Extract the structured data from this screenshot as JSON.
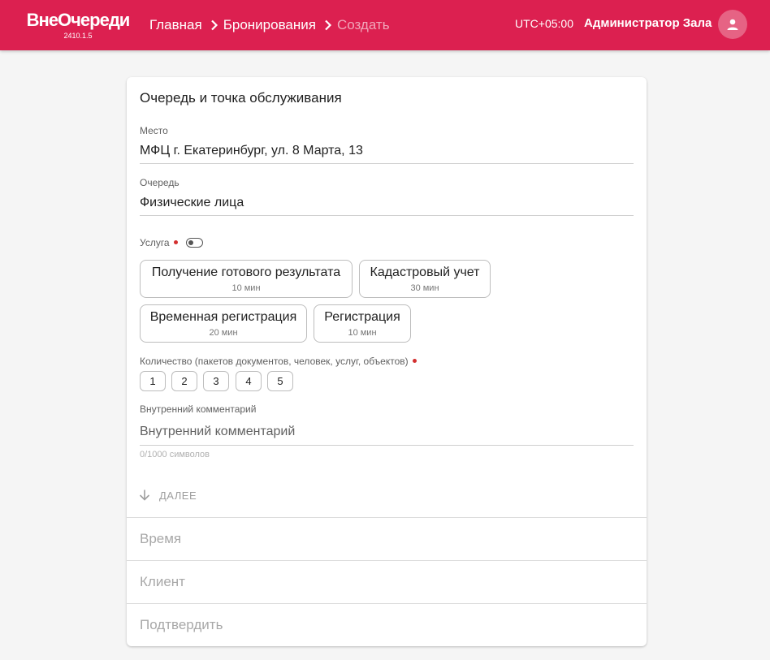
{
  "header": {
    "logo": "ВнеОчереди",
    "version": "2410.1.5",
    "breadcrumbs": [
      "Главная",
      "Бронирования",
      "Создать"
    ],
    "timezone": "UTC+05:00",
    "user_name": "Администратор Зала",
    "accent_color": "#dc2050"
  },
  "form": {
    "section_title": "Очередь и точка обслуживания",
    "place": {
      "label": "Место",
      "value": "МФЦ г. Екатеринбург, ул. 8 Марта, 13"
    },
    "queue": {
      "label": "Очередь",
      "value": "Физические лица"
    },
    "service": {
      "label": "Услуга",
      "options": [
        {
          "name": "Получение готового результата",
          "duration": "10 мин"
        },
        {
          "name": "Кадастровый учет",
          "duration": "30 мин"
        },
        {
          "name": "Временная регистрация",
          "duration": "20 мин"
        },
        {
          "name": "Регистрация",
          "duration": "10 мин"
        }
      ]
    },
    "quantity": {
      "label": "Количество (пакетов документов, человек, услуг, объектов)",
      "options": [
        "1",
        "2",
        "3",
        "4",
        "5"
      ]
    },
    "comment": {
      "label": "Внутренний комментарий",
      "placeholder": "Внутренний комментарий",
      "counter": "0/1000 символов"
    },
    "next_button": "ДАЛЕЕ"
  },
  "steps": [
    "Время",
    "Клиент",
    "Подтвердить"
  ]
}
